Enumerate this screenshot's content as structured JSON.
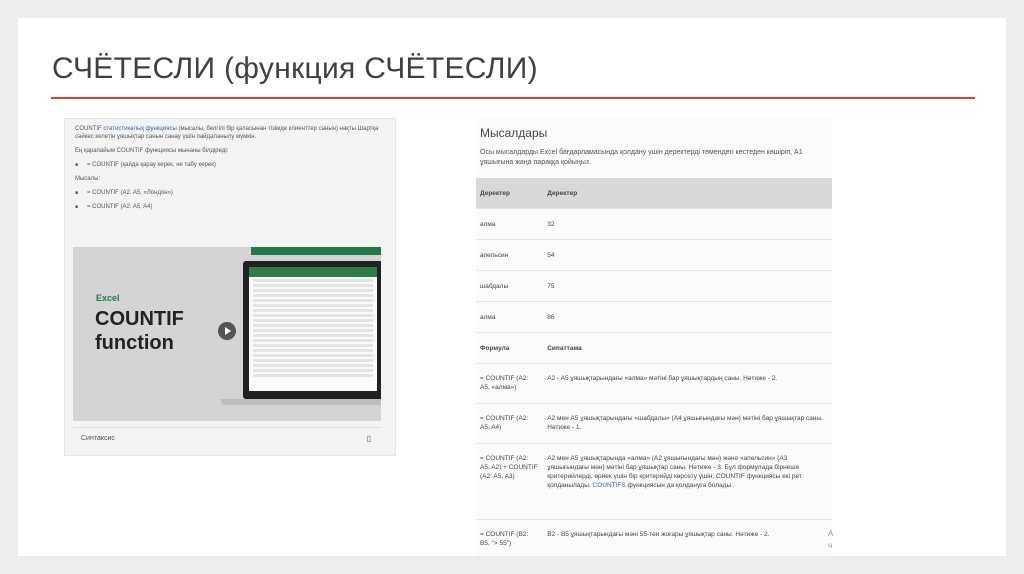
{
  "slide": {
    "title": "СЧЁТЕСЛИ (функция СЧЁТЕСЛИ)"
  },
  "left": {
    "para1_a": "COUNTIF ",
    "para1_link": "статистикалық функциясы",
    "para1_b": " (мысалы, белгілі бір қаласынан тізімде клиенттер санын) нақты Шартқа сәйкес келетін ұяшықтар санын санау үшін пайдаланылу мүмкін.",
    "para2": "Ең қарапайым COUNTIF функциясы мынаны білдіреді:",
    "bullet1": "= COUNTIF (қайда қарау керек, не табу керек)",
    "examples_label": "Мысалы:",
    "bullet2": "= COUNTIF (A2: A5, «Лондон»)",
    "bullet3": "= COUNTIF (A2: A5, A4)",
    "video": {
      "excel": "Excel",
      "line1": "COUNTIF",
      "line2": "function"
    },
    "syntax": "Синтаксис",
    "syntax_icon": "▯"
  },
  "right": {
    "heading": "Мысалдары",
    "desc": "Осы мысалдарды Excel бағдарламасында қолдану үшін деректерді төмендегі кестеден көшіріп, A1 ұяшығына жаңа параққа қойыңыз.",
    "col1": "Деректер",
    "col2": "Деректер",
    "data_rows": [
      {
        "a": "алма",
        "b": "32"
      },
      {
        "a": "апельсин",
        "b": "54"
      },
      {
        "a": "шабдалы",
        "b": "75"
      },
      {
        "a": "алма",
        "b": "86"
      }
    ],
    "formula_header": "Формула",
    "desc_header": "Сипаттама",
    "f1": "= COUNTIF (A2: A5, «алма»)",
    "d1": "A2 - A5 ұяшықтарындағы «алма» мәтіні бар ұяшықтардың саны. Нәтиже - 2.",
    "f2": "= COUNTIF (A2: A5, A4)",
    "d2": "A2 мен A5 ұяшықтарындағы «шабдалы» (A4 ұяшығындағы мән) мәтіні бар ұяшықтар саны. Нәтиже - 1.",
    "f3": "= COUNTIF (A2: A5, A2) + COUNTIF (A2: A5, A3)",
    "d3_a": "A2 мен A5 ұяшықтарында «алма» (A2 ұяшығындағы мән) және «апельсин» (A3 ұяшығындағы мән) мәтіні бар ұяшықтар саны. Нәтиже - 3. Бұл формулада бірнеше критерийлерді, өрнек үшін бір критерийді көрсету үшін, COUNTIF функциясы екі рет қолданылады. ",
    "d3_link": "COUNTIFS",
    "d3_b": " функциясын да қолдануға болады .",
    "f4": "= COUNTIF (B2: B5, \"> 55\")",
    "d4": "B2 - B5 ұяшықтарындағы мәні 55-тен жоғары ұяшықтар саны. Нәтиже - 2.",
    "edge": "А\nч"
  }
}
